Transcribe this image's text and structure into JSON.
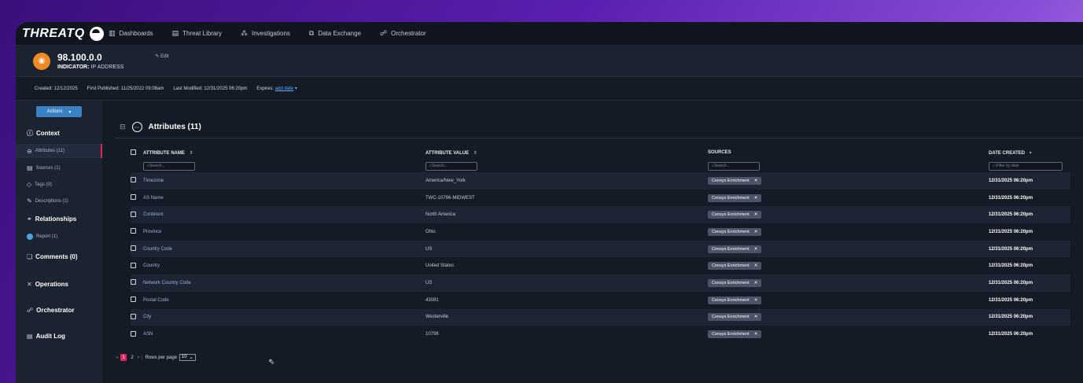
{
  "brand": "THREATQ",
  "nav": [
    {
      "label": "Dashboards",
      "icon": "bar-chart-icon"
    },
    {
      "label": "Threat Library",
      "icon": "library-icon"
    },
    {
      "label": "Investigations",
      "icon": "network-icon"
    },
    {
      "label": "Data Exchange",
      "icon": "data-exchange-icon"
    },
    {
      "label": "Orchestrator",
      "icon": "orchestrator-icon"
    }
  ],
  "indicator": {
    "title": "98.100.0.0",
    "type_label": "INDICATOR:",
    "type_value": "IP ADDRESS",
    "edit_label": "Edit"
  },
  "meta": {
    "created": "Created: 12/12/2025",
    "first_published": "First Published: 11/25/2022 09:08am",
    "last_modified": "Last Modified: 12/31/2025 06:20pm",
    "expires_label": "Expires:",
    "expires_link": "add date"
  },
  "sidebar": {
    "actions_label": "Actions",
    "context_label": "Context",
    "items": [
      {
        "label": "Attributes (11)"
      },
      {
        "label": "Sources (1)"
      },
      {
        "label": "Tags (0)"
      },
      {
        "label": "Descriptions (1)"
      }
    ],
    "relationships_label": "Relationships",
    "report_label": "Report (1)",
    "comments_label": "Comments (0)",
    "operations_label": "Operations",
    "orchestrator_label": "Orchestrator",
    "audit_label": "Audit Log"
  },
  "attributes": {
    "title": "Attributes (11)",
    "columns": {
      "name": "ATTRIBUTE NAME",
      "value": "ATTRIBUTE VALUE",
      "sources": "SOURCES",
      "date": "DATE CREATED"
    },
    "search_placeholder": "Search...",
    "date_placeholder": "Filter by date",
    "rows": [
      {
        "name": "Timezone",
        "value": "America/New_York",
        "source": "Censys Enrichment",
        "date": "12/31/2025 06:20pm"
      },
      {
        "name": "AS Name",
        "value": "TWC-10796-MIDWEST",
        "source": "Censys Enrichment",
        "date": "12/31/2025 06:20pm"
      },
      {
        "name": "Continent",
        "value": "North America",
        "source": "Censys Enrichment",
        "date": "12/31/2025 06:20pm"
      },
      {
        "name": "Province",
        "value": "Ohio",
        "source": "Censys Enrichment",
        "date": "12/31/2025 06:20pm"
      },
      {
        "name": "Country Code",
        "value": "US",
        "source": "Censys Enrichment",
        "date": "12/31/2025 06:20pm"
      },
      {
        "name": "Country",
        "value": "United States",
        "source": "Censys Enrichment",
        "date": "12/31/2025 06:20pm"
      },
      {
        "name": "Network Country Code",
        "value": "US",
        "source": "Censys Enrichment",
        "date": "12/31/2025 06:20pm"
      },
      {
        "name": "Postal Code",
        "value": "43081",
        "source": "Censys Enrichment",
        "date": "12/31/2025 06:20pm"
      },
      {
        "name": "City",
        "value": "Westerville",
        "source": "Censys Enrichment",
        "date": "12/31/2025 06:20pm"
      },
      {
        "name": "ASN",
        "value": "10796",
        "source": "Censys Enrichment",
        "date": "12/31/2025 06:20pm"
      }
    ]
  },
  "pager": {
    "pages": [
      "1",
      "2"
    ],
    "rows_per_page_label": "Rows per page",
    "rows_per_page_value": "10"
  },
  "colors": {
    "accent": "#e0245e",
    "primary_button": "#3b82c4",
    "indicator_avatar": "#f08a24"
  }
}
